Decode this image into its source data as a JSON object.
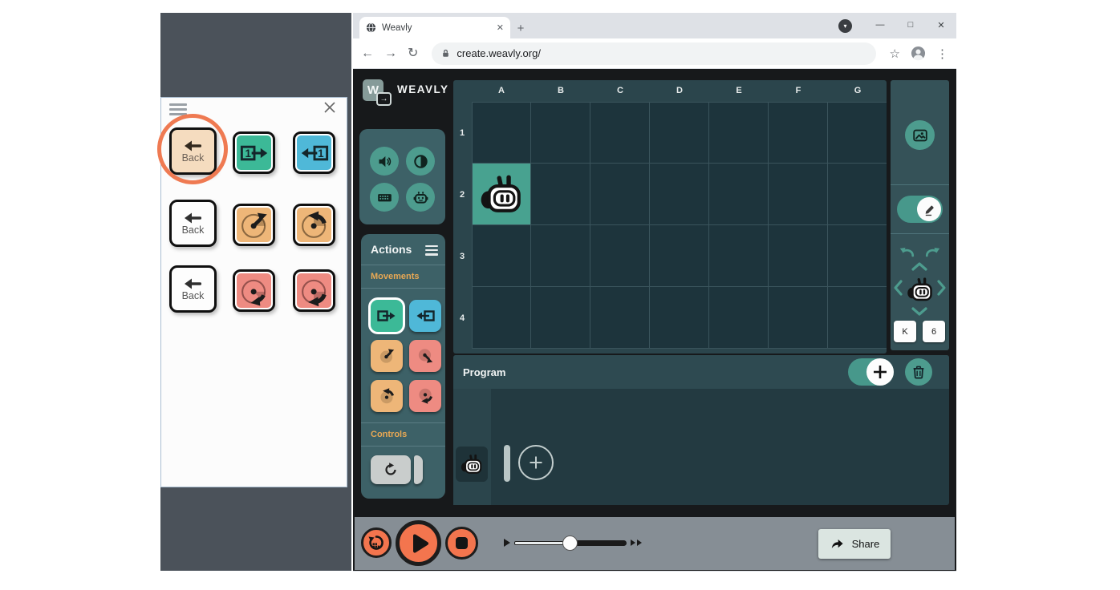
{
  "overlay": {
    "back_label": "Back",
    "step_digit": "1"
  },
  "browser": {
    "tab_title": "Weavly",
    "url": "create.weavly.org/",
    "icons": {
      "back": "←",
      "forward": "→",
      "reload": "↻",
      "star": "☆",
      "menu": "⋮",
      "new_tab": "+",
      "minimize": "—",
      "maximize": "□",
      "close": "✕",
      "tab_close": "✕",
      "profile_chip": "▾"
    }
  },
  "app": {
    "logo": {
      "letter": "W",
      "name": "WEAVLY",
      "arrow": "→"
    },
    "actions_panel": {
      "title": "Actions",
      "movements_label": "Movements",
      "controls_label": "Controls"
    },
    "world": {
      "columns": [
        "A",
        "B",
        "C",
        "D",
        "E",
        "F",
        "G"
      ],
      "rows": [
        "1",
        "2",
        "3",
        "4"
      ],
      "character": "robot",
      "character_cell": "A2"
    },
    "position_controls": {
      "column_label": "K",
      "row_label": "6"
    },
    "program_panel": {
      "title": "Program"
    },
    "playback": {
      "share_label": "Share",
      "speed_percent": 49
    },
    "colors": {
      "annotation_orange": "#ef7a52",
      "play_orange": "#f3754e",
      "teal_button": "#4d9c8e",
      "panel_teal": "#3d6167",
      "green_action": "#3cb997",
      "blue_action": "#4fb8d8",
      "orange_action": "#eeb678",
      "red_action": "#ee8b82",
      "active_cell": "#48a290",
      "section_label_orange": "#e8a854"
    }
  }
}
